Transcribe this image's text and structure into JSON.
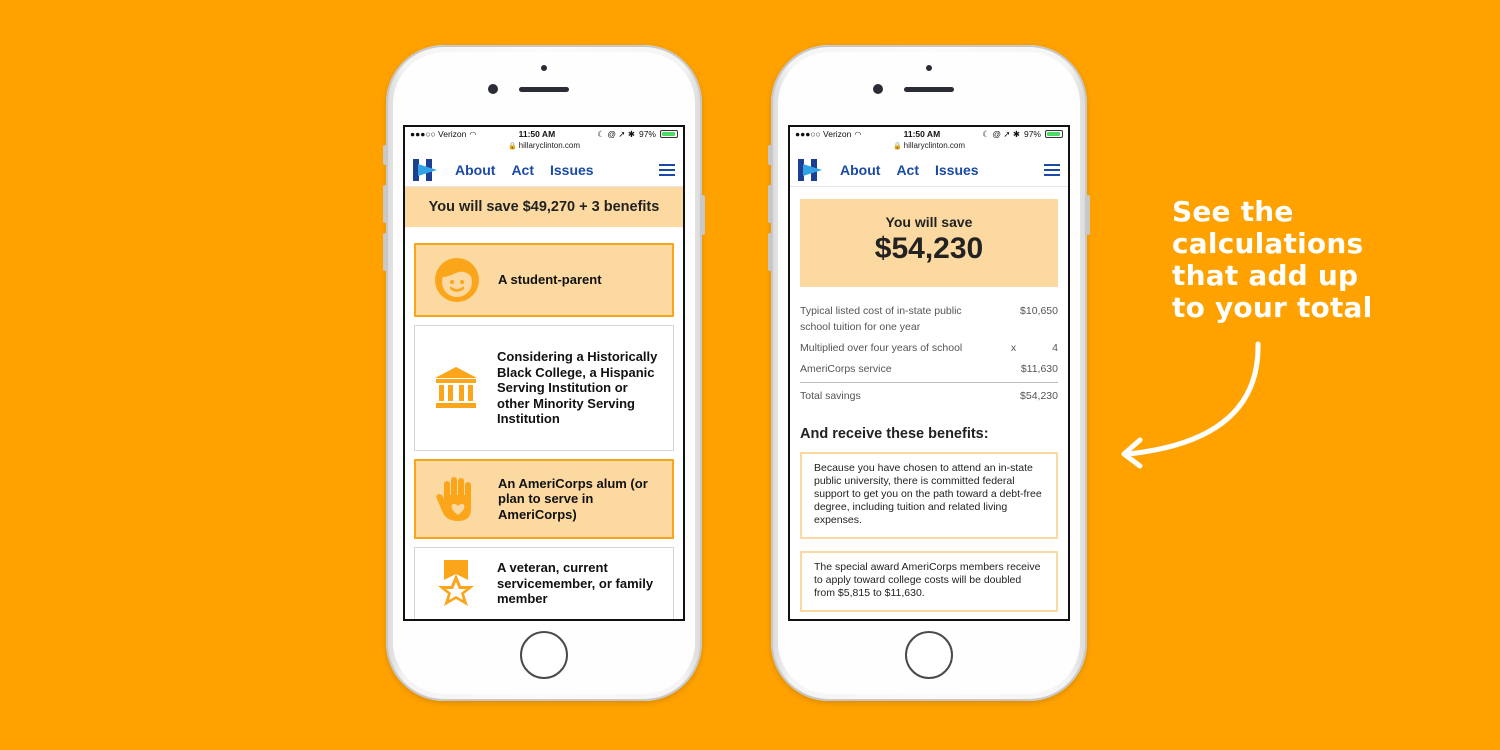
{
  "status_bar": {
    "carrier": "●●●○○ Verizon",
    "wifi": "wifi-icon",
    "time": "11:50 AM",
    "indicators": "☾ @ ➚ ✱",
    "battery_pct": "97%",
    "url": "hillaryclinton.com"
  },
  "nav": {
    "about": "About",
    "act": "Act",
    "issues": "Issues"
  },
  "screen1": {
    "banner": "You will save $49,270 + 3 benefits",
    "cards": [
      {
        "label": "A student-parent",
        "icon": "child-face-icon",
        "selected": true
      },
      {
        "label": "Considering a Historically Black College, a Hispanic Serving Institution or other Minority Serving Institution",
        "icon": "institution-building-icon",
        "selected": false
      },
      {
        "label": "An AmeriCorps alum (or plan to serve in AmeriCorps)",
        "icon": "hand-heart-icon",
        "selected": true
      },
      {
        "label": "A veteran, current servicemember, or family member",
        "icon": "medal-star-icon",
        "selected": false
      }
    ]
  },
  "screen2": {
    "total_label": "You will save",
    "total_amount": "$54,230",
    "calc": {
      "row1_label": "Typical listed cost of in-state public school tuition for one year",
      "row1_value": "$10,650",
      "row2_label": "Multiplied over four years of school",
      "row2_op": "x",
      "row2_value": "4",
      "row3_label": "AmeriCorps service",
      "row3_value": "$11,630",
      "total_label": "Total savings",
      "total_value": "$54,230"
    },
    "benefits_heading": "And receive these benefits:",
    "benefits": [
      "Because you have chosen to attend an in-state public university, there is committed federal support to get you on the path toward a debt-free degree, including tuition and related living expenses.",
      "The special award AmeriCorps members receive to apply toward college costs will be doubled from $5,815 to $11,630."
    ]
  },
  "callout": {
    "line1": "See the",
    "line2": "calculations",
    "line3": "that add up",
    "line4": "to your total"
  },
  "colors": {
    "background": "#FFA200",
    "highlight": "#FBD9A0",
    "accent": "#FBA61A",
    "nav_blue": "#1a4aa3"
  }
}
